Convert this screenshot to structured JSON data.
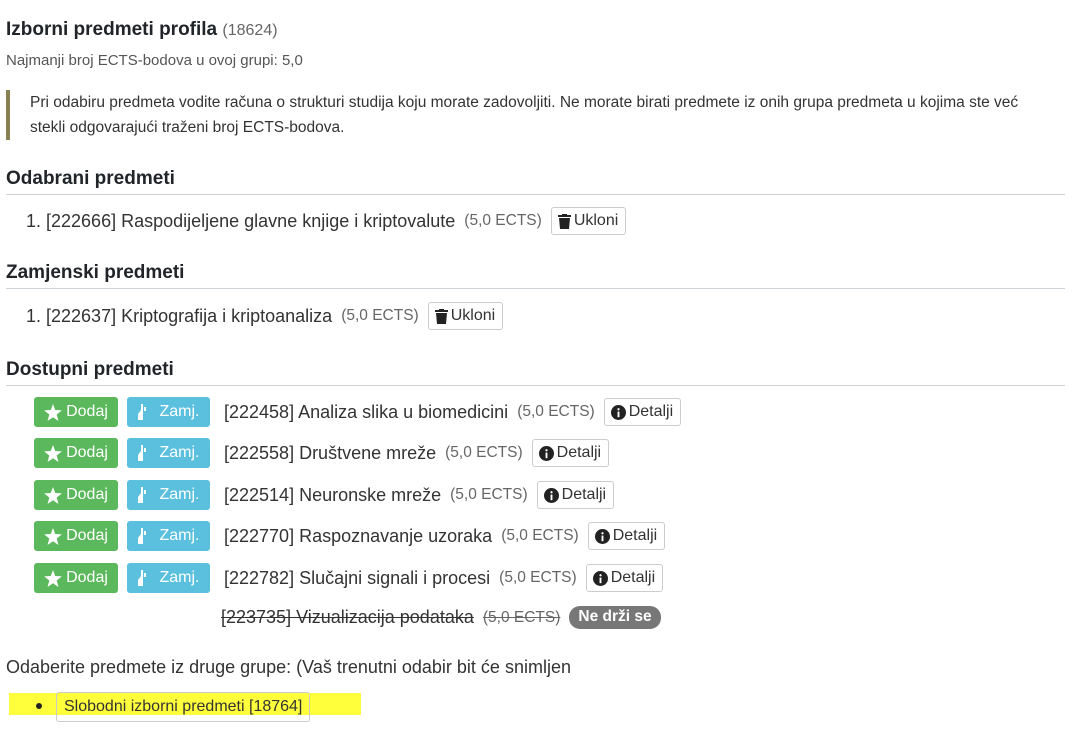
{
  "header": {
    "title": "Izborni predmeti profila",
    "code": "(18624)",
    "min_ects": "Najmanji broj ECTS-bodova u ovoj grupi: 5,0"
  },
  "note": "Pri odabiru predmeta vodite računa o strukturi studija koju morate zadovoljiti. Ne morate birati predmete iz onih grupa predmeta u kojima ste već stekli odgovarajući traženi broj ECTS-bodova.",
  "selected": {
    "heading": "Odabrani predmeti",
    "items": [
      {
        "text": "1. [222666] Raspodijeljene glavne knjige i kriptovalute",
        "ects": "(5,0 ECTS)",
        "button": "Ukloni"
      }
    ]
  },
  "substitute": {
    "heading": "Zamjenski predmeti",
    "items": [
      {
        "text": "1. [222637] Kriptografija i kriptoanaliza",
        "ects": "(5,0 ECTS)",
        "button": "Ukloni"
      }
    ]
  },
  "available": {
    "heading": "Dostupni predmeti",
    "add_label": "Dodaj",
    "sub_label": "Zamj.",
    "details_label": "Detalji",
    "items": [
      {
        "name": "[222458] Analiza slika u biomedicini",
        "ects": "(5,0 ECTS)"
      },
      {
        "name": "[222558] Društvene mreže",
        "ects": "(5,0 ECTS)"
      },
      {
        "name": "[222514] Neuronske mreže",
        "ects": "(5,0 ECTS)"
      },
      {
        "name": "[222770] Raspoznavanje uzoraka",
        "ects": "(5,0 ECTS)"
      },
      {
        "name": "[222782] Slučajni signali i procesi",
        "ects": "(5,0 ECTS)"
      }
    ],
    "inactive": {
      "name": "[223735] Vizualizacija podataka",
      "ects": "(5,0 ECTS)",
      "badge": "Ne drži se"
    }
  },
  "other_groups": {
    "text": "Odaberite predmete iz druge grupe: (Vaš trenutni odabir bit će snimljen",
    "groups": [
      "Slobodni izborni predmeti [18764]"
    ]
  },
  "colors": {
    "success": "#5cb85c",
    "info": "#5bc0de",
    "highlight": "#ffff3c",
    "note_border": "#8a8151"
  },
  "icons": {
    "remove": "trash-icon",
    "add": "star-icon",
    "substitute": "hand-icon",
    "details": "info-icon"
  }
}
